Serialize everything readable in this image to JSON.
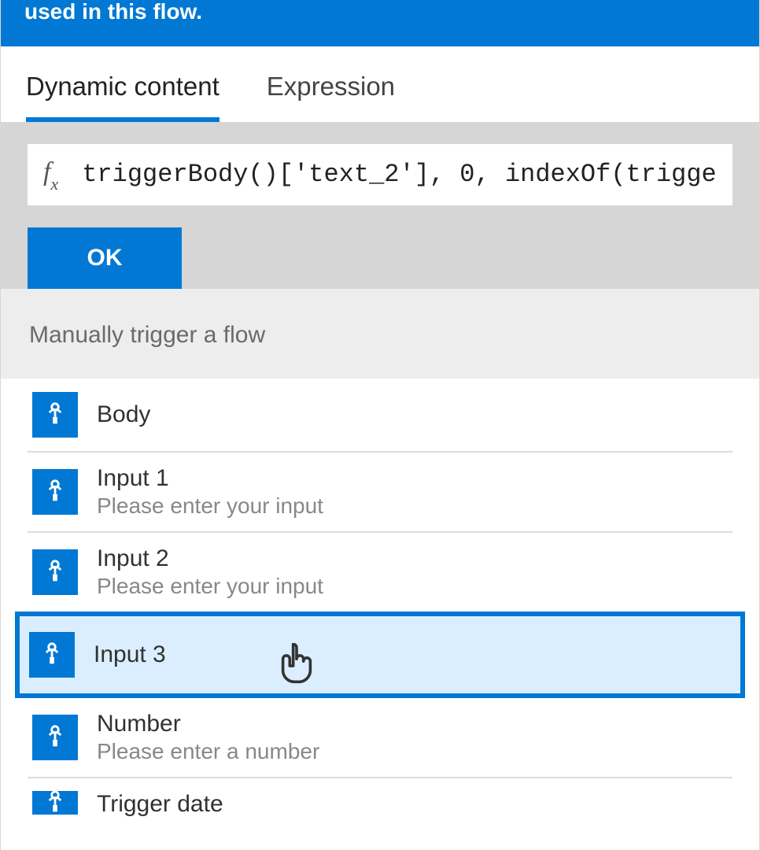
{
  "banner": {
    "text": "used in this flow."
  },
  "tabs": {
    "dynamic": "Dynamic content",
    "expression": "Expression"
  },
  "expression": {
    "fx": "f",
    "fx_sub": "x",
    "value": "triggerBody()['text_2'], 0, indexOf(trigge",
    "ok_label": "OK"
  },
  "section": {
    "title": "Manually trigger a flow"
  },
  "items": [
    {
      "title": "Body",
      "desc": ""
    },
    {
      "title": "Input 1",
      "desc": "Please enter your input"
    },
    {
      "title": "Input 2",
      "desc": "Please enter your input"
    },
    {
      "title": "Input 3",
      "desc": "",
      "highlighted": true
    },
    {
      "title": "Number",
      "desc": "Please enter a number"
    },
    {
      "title": "Trigger date",
      "desc": ""
    }
  ],
  "colors": {
    "accent": "#0078d4",
    "highlight_bg": "#dbeeff"
  }
}
